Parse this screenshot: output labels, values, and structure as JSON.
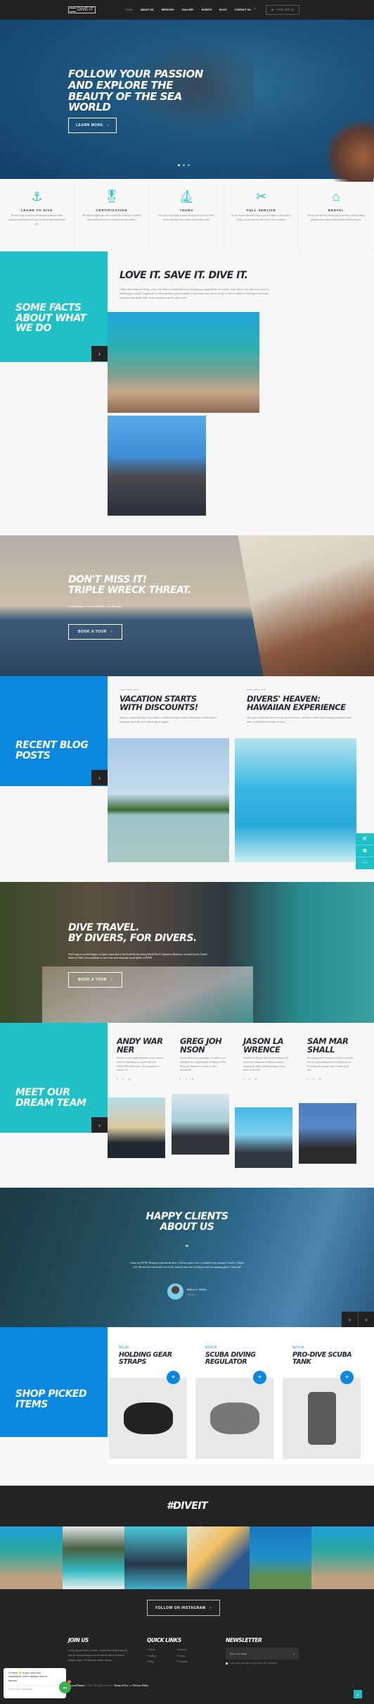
{
  "header": {
    "logo": "DIVE.IT",
    "nav": [
      "HOME",
      "ABOUT US",
      "SERVICES",
      "GALLERY",
      "EVENTS",
      "BLOG",
      "CONTACT US"
    ],
    "active": "HOME",
    "cart_label": "YOUR CART (0)"
  },
  "hero": {
    "title": "FOLLOW YOUR PASSION AND EXPLORE THE BEAUTY OF THE SEA WORLD",
    "button": "LEARN MORE",
    "slides": 3,
    "active_slide": 1
  },
  "features": [
    {
      "icon": "anchor-icon",
      "title": "LEARN TO DIVE",
      "text": "We hire only certified professional instructors with training experience to let you see all diving benefits and joy."
    },
    {
      "icon": "award-ribbon-icon",
      "title": "CERTIFICATION",
      "text": "We help all applicants who would like to become certified divers and instructors to achieve the best results."
    },
    {
      "icon": "sailboat-icon",
      "title": "TOURS",
      "text": "Get away from daily routine and join us in a tour to the most amazing exotic places around the world."
    },
    {
      "icon": "tools-icon",
      "title": "FULL SERVICE",
      "text": "If you haven't decided which course to take or what tour to book, you can use our full service list to choose."
    },
    {
      "icon": "fins-icon",
      "title": "RENTAL",
      "text": "We provide the best diving rental services, and including professional courses with modern and secure gear."
    }
  ],
  "facts": {
    "label": "SOME FACTS ABOUT WHAT WE DO",
    "title": "LOVE IT. SAVE IT. DIVE IT.",
    "text": "Unlike other modes of diving, which rely either on breath-hold or on breathing gas pumped from the surface, scuba divers carry their own source of breathing gas, usually compressed air, allowing them greater freedom of movement than with an air line or diver's umbilical and longer underwater endurance than breath-hold. Scuba equipment may be open circuit."
  },
  "promo1": {
    "title_line1": "DON'T MISS IT!",
    "title_line2": "TRIPLE WRECK THREAT.",
    "subtitle": "3 breathtaking wrecks packed into 1 fun filled day!",
    "button": "BOOK A TOUR"
  },
  "blog": {
    "label": "RECENT BLOG POSTS",
    "posts": [
      {
        "date": "Posted June 6, 2016",
        "title": "VACATION STARTS WITH DISCOUNTS!",
        "excerpt": "Inland or onshore diving is very similar to offshore diving in terms of the nature of work and the equipment used, the work often being in support..."
      },
      {
        "date": "Posted June 3, 2016",
        "title": "DIVERS' HEAVEN: HAWAIIAN EXPERIENCE",
        "excerpt": "The types of dive sites this covers is varied, however, and divers can be found working in harbours and lakes, on hydroelectric dams, in rivers..."
      }
    ]
  },
  "promo2": {
    "title_line1": "DIVE TRAVEL.",
    "title_line2": "BY DIVERS, FOR DIVERS.",
    "text": "Truk Lagoon was the Empire of Japan's main base in the South Pacific during World War II. Operation Hailstone, executed by the United States in 1944, was considered as one of the most important naval battles of WWII.",
    "button": "BOOK A TOUR"
  },
  "team": {
    "label": "MEET OUR DREAM TEAM",
    "members": [
      {
        "name": "ANDY WARNER",
        "text": "We have a very high candidate success rate as well as a reputation for producing well trained Dive Instructors. The program is a mixture of..."
      },
      {
        "name": "GREG JOHNSON",
        "text": "You also have the opportunity to further your education by completing the Emergency First Response Instructor Course or other specialities."
      },
      {
        "name": "JASON LAWRENCE",
        "text": "Students of all ages and all nationalities will enter your classroom looking forward to learning the skills and knowledge you are about to provide..."
      },
      {
        "name": "SAM MARSHALL",
        "text": "Becoming a dive instructor enriches your life. You are guaranteed personal satisfaction as you help other people achieve their goals and..."
      }
    ]
  },
  "testimonials": {
    "title": "HAPPY CLIENTS ABOUT US",
    "quote": "I must say WOW! Being an experienced diver, I did not expect such a wonderful tour coming! I loved it. Thanks a lot. Me and my friends had a lot of fun, learned some new techniques and saw amazing places. Great job!",
    "name": "KELLY JOEL",
    "role": "Manager"
  },
  "shop": {
    "label": "SHOP PICKED ITEMS",
    "products": [
      {
        "price": "$85.00",
        "name": "HOLDING GEAR STRAPS"
      },
      {
        "price": "$350.90",
        "name": "SCUBA DIVING REGULATOR"
      },
      {
        "price": "$470.00",
        "name": "PRO-DIVE SCUBA TANK"
      }
    ]
  },
  "instagram": {
    "hashtag": "#DIVEIT",
    "button": "FOLLOW ON INSTAGRAM"
  },
  "footer": {
    "join_title": "JOIN US",
    "join_text": "Lorem ipsum dolor sit amet, consectetur adipiscing elit, sed do eiusmod tempor incid dunt ut labore et dolore magna aliqua. Ut enim ad minim veniam.",
    "links_title": "QUICK LINKS",
    "links": [
      "About",
      "Services",
      "Gallery",
      "Events",
      "Blog",
      "Contacts"
    ],
    "newsletter_title": "NEWSLETTER",
    "email_placeholder": "Enter you email",
    "agree": "I have read and agree to the terms & conditions",
    "copyright_brand": "AncoraThemes",
    "copyright": "© 2022. All rights reserved.",
    "terms": "Terms of Use",
    "and": "and",
    "privacy": "Privacy Policy"
  },
  "chat": {
    "message": "Hi there 👋 If you need any assistance, We're always here to answer.",
    "placeholder": "Enter your message...",
    "badge": "1"
  },
  "colors": {
    "teal": "#20c1c6",
    "blue": "#0a88e0",
    "dark": "#222222"
  }
}
